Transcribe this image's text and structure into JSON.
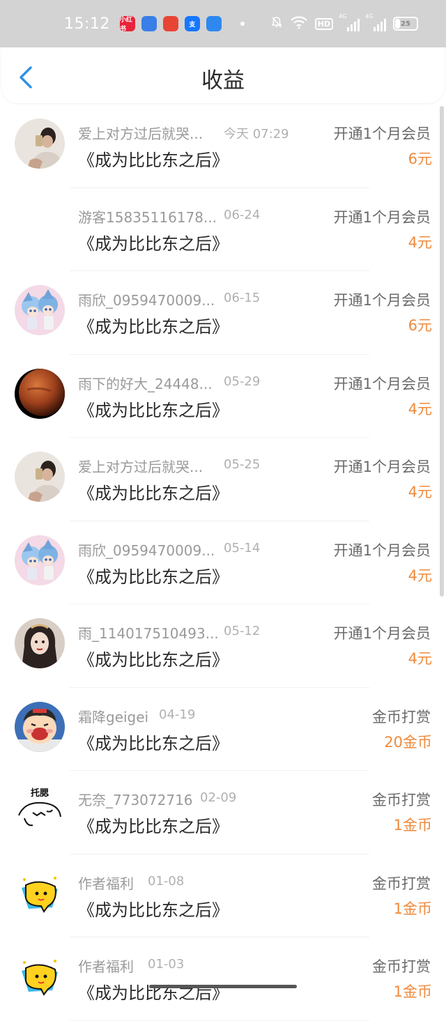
{
  "status_bar": {
    "time": "15:12",
    "apps": [
      {
        "name": "xiaohongshu-app-icon",
        "label": "小红书",
        "color": "#e8233a"
      },
      {
        "name": "messages-app-icon",
        "label": "",
        "color": "#3a7ee8"
      },
      {
        "name": "video-app-icon",
        "label": "",
        "color": "#e84436"
      },
      {
        "name": "alipay-app-icon",
        "label": "支",
        "color": "#1677ff"
      },
      {
        "name": "browser-app-icon",
        "label": "",
        "color": "#2e88f0"
      }
    ],
    "hd_label": "HD",
    "network_label": "4G",
    "battery_level": "25",
    "battery_fill": 0.25
  },
  "header": {
    "title": "收益"
  },
  "rows": [
    {
      "name": "爱上对方过后就哭...",
      "date": "今天 07:29",
      "book": "《成为比比东之后》",
      "type": "开通1个月会员",
      "amount": "6元",
      "avatar": "girl-photo"
    },
    {
      "name": "游客15835116178...",
      "date": "06-24",
      "book": "《成为比比东之后》",
      "type": "开通1个月会员",
      "amount": "4元",
      "avatar": "none"
    },
    {
      "name": "雨欣_0959470009...",
      "date": "06-15",
      "book": "《成为比比东之后》",
      "type": "开通1个月会员",
      "amount": "6元",
      "avatar": "anime-pair"
    },
    {
      "name": "雨下的好大_24448...",
      "date": "05-29",
      "book": "《成为比比东之后》",
      "type": "开通1个月会员",
      "amount": "4元",
      "avatar": "mars-planet"
    },
    {
      "name": "爱上对方过后就哭...",
      "date": "05-25",
      "book": "《成为比比东之后》",
      "type": "开通1个月会员",
      "amount": "4元",
      "avatar": "girl-photo"
    },
    {
      "name": "雨欣_0959470009...",
      "date": "05-14",
      "book": "《成为比比东之后》",
      "type": "开通1个月会员",
      "amount": "4元",
      "avatar": "anime-pair"
    },
    {
      "name": "雨_114017510493...",
      "date": "05-12",
      "book": "《成为比比东之后》",
      "type": "开通1个月会员",
      "amount": "4元",
      "avatar": "portrait"
    },
    {
      "name": "霜降geigei",
      "date": "04-19",
      "book": "《成为比比东之后》",
      "type": "金币打赏",
      "amount": "20金币",
      "avatar": "cartoon-boy"
    },
    {
      "name": "无奈_773072716",
      "date": "02-09",
      "book": "《成为比比东之后》",
      "type": "金币打赏",
      "amount": "1金币",
      "avatar": "sketch-face"
    },
    {
      "name": "作者福利",
      "date": "01-08",
      "book": "《成为比比东之后》",
      "type": "金币打赏",
      "amount": "1金币",
      "avatar": "yellow-bubble"
    },
    {
      "name": "作者福利",
      "date": "01-03",
      "book": "《成为比比东之后》",
      "type": "金币打赏",
      "amount": "1金币",
      "avatar": "yellow-bubble"
    }
  ],
  "sketch_caption": "托腮"
}
